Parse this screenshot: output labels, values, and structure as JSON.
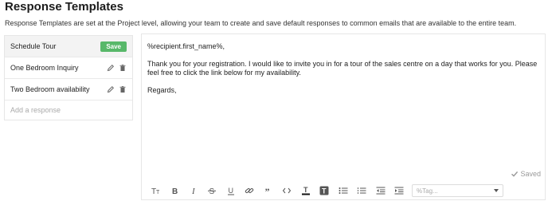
{
  "page": {
    "title": "Response Templates",
    "description": "Response Templates are set at the Project level, allowing your team to create and save default responses to common emails that are available to the entire team."
  },
  "sidebar": {
    "items": [
      {
        "label": "Schedule Tour",
        "active": true,
        "action_label": "Save"
      },
      {
        "label": "One Bedroom Inquiry",
        "icons": [
          "pencil-icon",
          "trash-icon"
        ]
      },
      {
        "label": "Two Bedroom availability",
        "icons": [
          "pencil-icon",
          "trash-icon"
        ]
      }
    ],
    "add_placeholder": "Add a response"
  },
  "editor": {
    "lines": [
      "%recipient.first_name%,",
      "",
      "Thank you for your registration. I would like to invite you in for a tour of the sales centre on a day that works for you. Please feel free to click the link below for my availability.",
      "",
      "Regards,"
    ],
    "saved_label": "Saved",
    "tag_placeholder": "%Tag..."
  },
  "toolbar": {
    "icons": [
      "text-size-icon",
      "bold-icon",
      "italic-icon",
      "strikethrough-icon",
      "underline-icon",
      "link-icon",
      "quote-icon",
      "code-icon",
      "text-color-icon",
      "text-background-icon",
      "bulleted-list-icon",
      "numbered-list-icon",
      "outdent-icon",
      "indent-icon"
    ]
  },
  "colors": {
    "save_button": "#58b86a",
    "border": "#e6e6e6",
    "active_item_bg": "#f3f3f3"
  }
}
